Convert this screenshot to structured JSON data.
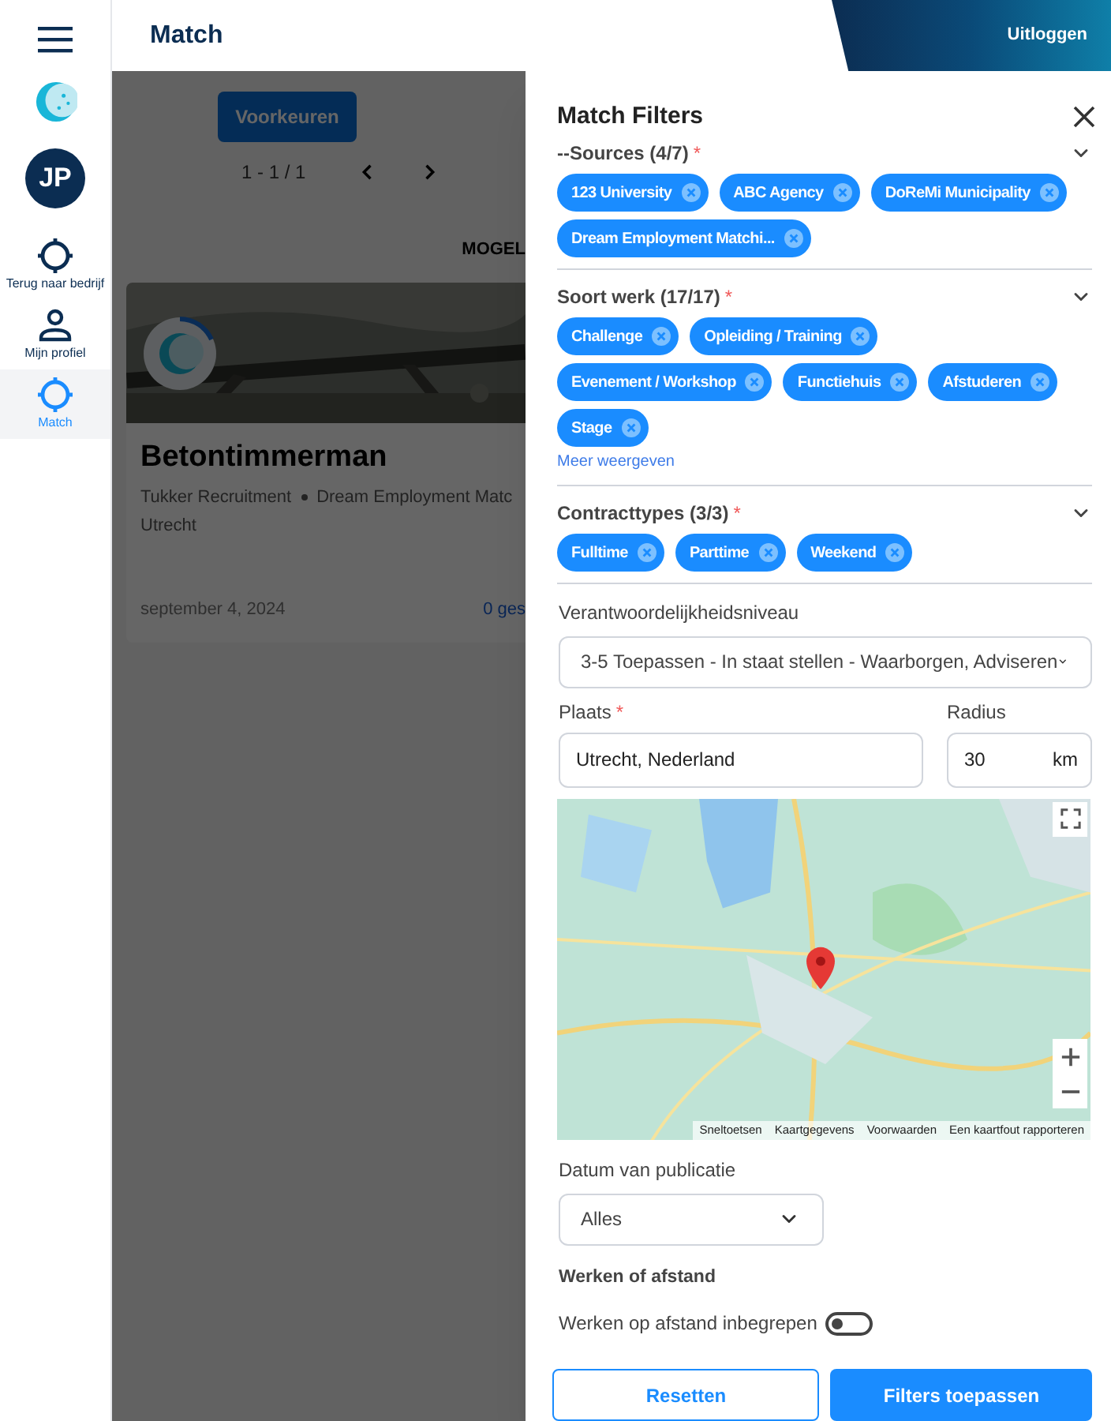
{
  "header": {
    "title": "Match",
    "logout": "Uitloggen"
  },
  "sidebar": {
    "avatar": "JP",
    "items": [
      {
        "kind": "target",
        "label": "Terug naar bedrijf",
        "selected": false
      },
      {
        "kind": "person",
        "label": "Mijn profiel",
        "selected": false
      },
      {
        "kind": "target",
        "label": "Match",
        "selected": true
      }
    ]
  },
  "main": {
    "preferences_button": "Voorkeuren",
    "pagination": "1 - 1 / 1",
    "column_heading": "MOGEL",
    "card": {
      "title": "Betontimmerman",
      "company": "Tukker Recruitment",
      "source": "Dream Employment Matc",
      "location": "Utrecht",
      "date": "september 4, 2024",
      "count": "0 ges"
    }
  },
  "filters": {
    "title": "Match Filters",
    "groups": [
      {
        "label": "--Sources (4/7)",
        "required_mark": "*",
        "chips": [
          "123 University",
          "ABC Agency",
          "DoReMi Municipality",
          "Dream Employment Matchi..."
        ]
      },
      {
        "label": "Soort werk (17/17)",
        "required_mark": "*",
        "chips": [
          "Challenge",
          "Opleiding / Training",
          "Evenement / Workshop",
          "Functiehuis",
          "Afstuderen",
          "Stage"
        ],
        "more_link": "Meer weergeven"
      },
      {
        "label": "Contracttypes (3/3)",
        "required_mark": "*",
        "chips": [
          "Fulltime",
          "Parttime",
          "Weekend"
        ]
      }
    ],
    "level": {
      "label": "Verantwoordelijkheidsniveau",
      "value": "3-5 Toepassen - In staat stellen - Waarborgen, Adviseren"
    },
    "place": {
      "label": "Plaats",
      "required_mark": "*",
      "value": "Utrecht, Nederland"
    },
    "radius": {
      "label": "Radius",
      "value": "30",
      "unit": "km"
    },
    "map": {
      "kind": "picture",
      "links": [
        "Sneltoetsen",
        "Kaartgegevens",
        "Voorwaarden",
        "Een kaartfout rapporteren"
      ]
    },
    "date": {
      "label": "Datum van publicatie",
      "value": "Alles"
    },
    "remote": {
      "heading": "Werken of afstand",
      "label": "Werken op afstand inbegrepen",
      "on": false
    },
    "buttons": {
      "reset": "Resetten",
      "apply": "Filters toepassen"
    }
  }
}
